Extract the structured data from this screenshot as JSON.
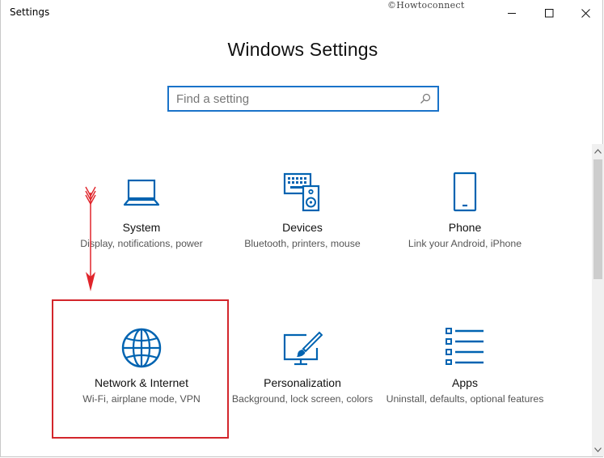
{
  "window": {
    "app_title": "Settings",
    "watermark": "©Howtoconnect",
    "controls": [
      "minimize",
      "maximize",
      "close"
    ]
  },
  "page_title": "Windows Settings",
  "search": {
    "placeholder": "Find a setting",
    "value": "",
    "icon": "search-icon"
  },
  "tiles": [
    {
      "name": "System",
      "description": "Display, notifications, power",
      "icon": "laptop-icon"
    },
    {
      "name": "Devices",
      "description": "Bluetooth, printers, mouse",
      "icon": "keyboard-speaker-icon"
    },
    {
      "name": "Phone",
      "description": "Link your Android, iPhone",
      "icon": "phone-icon"
    },
    {
      "name": "Network & Internet",
      "description": "Wi-Fi, airplane mode, VPN",
      "icon": "globe-icon"
    },
    {
      "name": "Personalization",
      "description": "Background, lock screen, colors",
      "icon": "paint-brush-screen-icon"
    },
    {
      "name": "Apps",
      "description": "Uninstall, defaults, optional features",
      "icon": "list-icon"
    }
  ],
  "annotation": {
    "highlight_color": "#d3262c",
    "arrow_color": "#e0242a",
    "highlighted_tile": "Network & Internet"
  },
  "colors": {
    "accent": "#1a73c9",
    "icon": "#0063b1",
    "text": "#111111",
    "secondary_text": "#555555"
  }
}
